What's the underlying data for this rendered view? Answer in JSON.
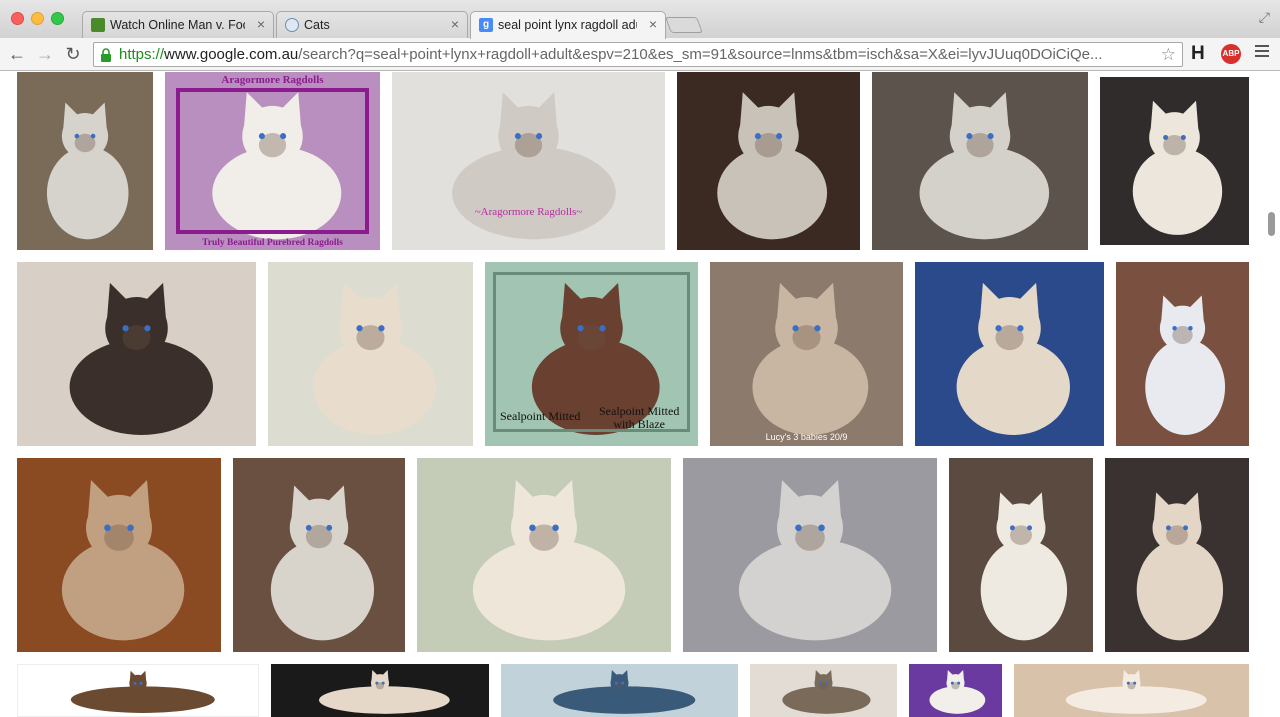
{
  "browser": {
    "tabs": [
      {
        "title": "Watch Online Man v. Food",
        "close": "×",
        "active": false,
        "favicon_color": "#4a8a2a"
      },
      {
        "title": "Cats",
        "close": "×",
        "active": false,
        "favicon_color": "#6d8fb4"
      },
      {
        "title": "seal point lynx ragdoll adu",
        "close": "×",
        "active": true,
        "favicon_color": "#4a8af4"
      }
    ],
    "url": {
      "scheme": "https://",
      "host": "www.google.com.au",
      "path": "/search?q=seal+point+lynx+ragdoll+adult&espv=210&es_sm=91&source=lnms&tbm=isch&sa=X&ei=lyvJUuq0DOiCiQe..."
    },
    "extensions": {
      "h_label": "H",
      "abp_label": "ABP"
    },
    "icons": {
      "back": "←",
      "forward": "→",
      "reload": "↻",
      "star": "☆",
      "fullscreen": "⤢"
    }
  },
  "results": {
    "row1": [
      {
        "bg": "#7a6a58",
        "fg": "#d6d2cc"
      },
      {
        "caption_top": "Aragormore Ragdolls",
        "caption_bottom": "Truly Beautiful Purebred Ragdolls",
        "bg": "#b98fbf",
        "fg": "#f1eee9"
      },
      {
        "watermark": "~Aragormore Ragdolls~",
        "bg": "#e2e0dc",
        "fg": "#cfcac4"
      },
      {
        "bg": "#3a2a22",
        "fg": "#c9c2b8"
      },
      {
        "bg": "#5b534c",
        "fg": "#d4d0ca"
      },
      {
        "bg": "#2f2c2b",
        "fg": "#ece6dd"
      }
    ],
    "row2": [
      {
        "bg": "#d8d0c6",
        "fg": "#3a2f2a"
      },
      {
        "bg": "#dcdcd0",
        "fg": "#e8dccc"
      },
      {
        "label_left": "Sealpoint Mitted",
        "label_right_1": "Sealpoint Mitted",
        "label_right_2": "with Blaze",
        "bg": "#a2c4b2",
        "fg": "#6a4030"
      },
      {
        "caption": "Lucy's 3 babies 20/9",
        "bg": "#8c7a6c",
        "fg": "#c9b6a2"
      },
      {
        "bg": "#2b4a8c",
        "fg": "#e4d8c8"
      },
      {
        "bg": "#7a5040",
        "fg": "#e8eaf0"
      }
    ],
    "row3": [
      {
        "bg": "#8a4a22",
        "fg": "#c0a080"
      },
      {
        "bg": "#6a5040",
        "fg": "#d8d4cc"
      },
      {
        "bg": "#c4ccb8",
        "fg": "#efe6da"
      },
      {
        "bg": "#9a9aa0",
        "fg": "#d4d2d0"
      },
      {
        "bg": "#5a4a40",
        "fg": "#eeeae2"
      },
      {
        "bg": "#3a3230",
        "fg": "#e4d6c6"
      }
    ],
    "row4": [
      {
        "bg": "#ffffff",
        "fg": "#6a4a30"
      },
      {
        "bg": "#1a1a1a",
        "fg": "#e6d8c8"
      },
      {
        "bg": "#c2d2da",
        "fg": "#3a5a7a"
      },
      {
        "bg": "#e2dcd4",
        "fg": "#7a6a5a"
      },
      {
        "bg": "#6a3aa0",
        "fg": "#f2eeea"
      },
      {
        "bg": "#d8c2aa",
        "fg": "#f4ece2"
      }
    ]
  }
}
